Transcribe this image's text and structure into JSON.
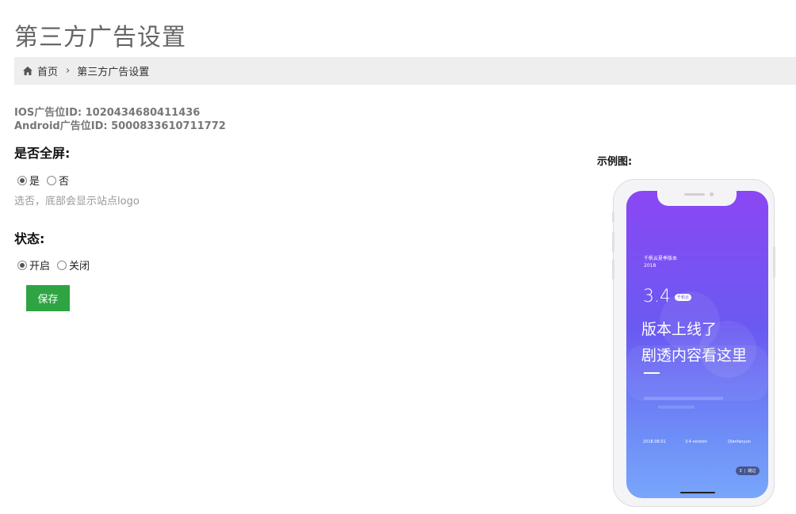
{
  "page": {
    "title": "第三方广告设置"
  },
  "breadcrumb": {
    "home": "首页",
    "current": "第三方广告设置"
  },
  "ad_ids": {
    "ios": "IOS广告位ID: 1020434680411436",
    "android": "Android广告位ID: 5000833610711772"
  },
  "fullscreen": {
    "label": "是否全屏:",
    "options": [
      "是",
      "否"
    ],
    "selected": "是",
    "hint": "选否，底部会显示站点logo"
  },
  "status": {
    "label": "状态:",
    "options": [
      "开启",
      "关闭"
    ],
    "selected": "开启"
  },
  "save_button": "保存",
  "example": {
    "label": "示例图:",
    "screen": {
      "small_title": "千帆云夏季版本",
      "year": "2018",
      "version_big": "3.4",
      "badge": "千帆云",
      "headline_1": "版本上线了",
      "headline_2": "剧透内容看这里",
      "footer_date": "2018.08.01",
      "footer_version": "3.4 version",
      "footer_brand": "Qianfanyun",
      "skip_count": "3",
      "skip_label": "跳过"
    }
  }
}
